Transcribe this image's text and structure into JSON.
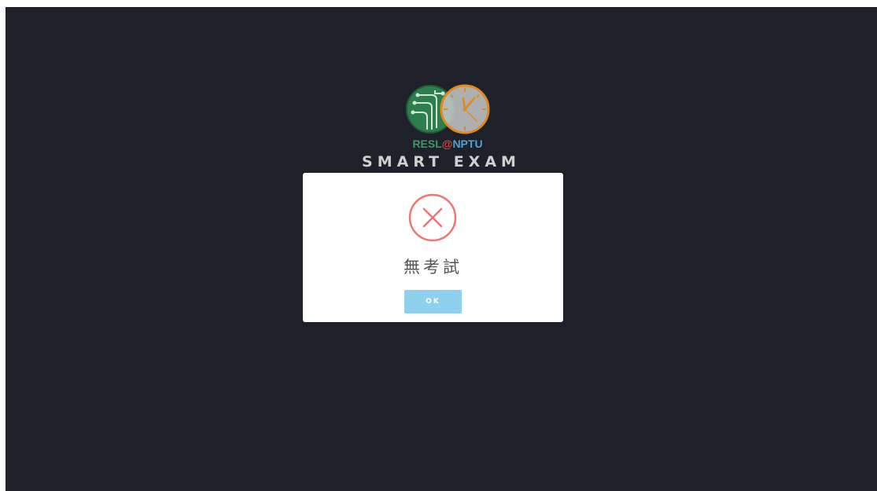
{
  "brand": {
    "logo_text_left": "RESL",
    "logo_text_at": "@",
    "logo_text_right": "NPTU",
    "title": "SMART EXAM"
  },
  "modal": {
    "icon": "error-x-circle-icon",
    "message": "無考試",
    "ok_label": "OK"
  },
  "colors": {
    "background": "#1e2129",
    "error": "#f27474",
    "button": "#8fd0ee",
    "logo_green": "#2e7d4f",
    "logo_orange": "#e08a1e"
  }
}
